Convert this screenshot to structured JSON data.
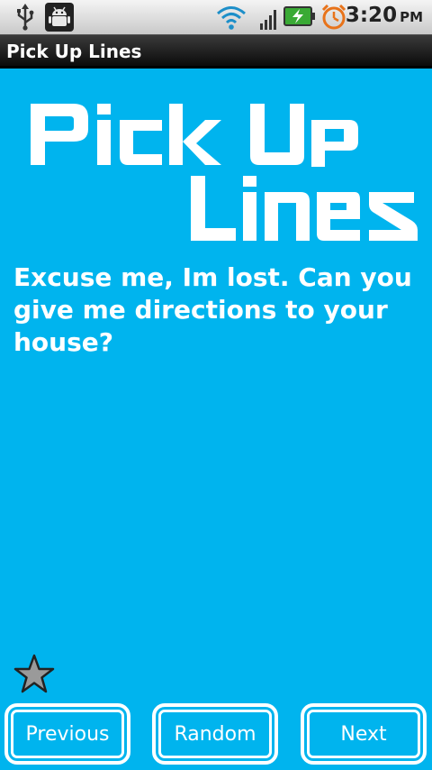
{
  "status_bar": {
    "time": "3:20",
    "ampm": "PM",
    "icons": [
      "usb-icon",
      "android-debug-icon",
      "wifi-icon",
      "signal-icon",
      "battery-charging-icon",
      "alarm-icon"
    ]
  },
  "title_bar": {
    "title": "Pick Up Lines"
  },
  "logo": {
    "line1": "Pick Up",
    "line2": "Lines"
  },
  "content": {
    "pickup_line": "Excuse me, Im lost. Can you give me directions to your house?"
  },
  "favorite": {
    "icon": "star-icon",
    "fill_color": "#9a9a9a"
  },
  "buttons": {
    "previous": "Previous",
    "random": "Random",
    "next": "Next"
  },
  "colors": {
    "background": "#00b4ee",
    "text": "#ffffff"
  }
}
